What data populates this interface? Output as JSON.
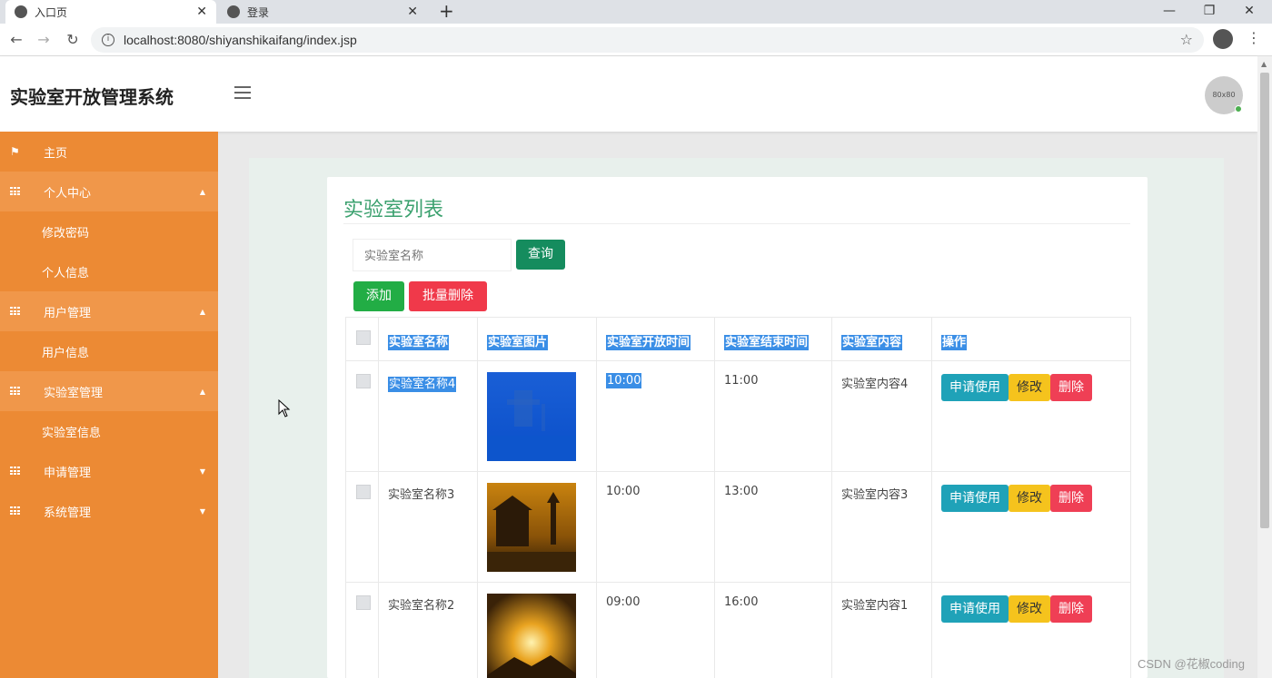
{
  "browser": {
    "tabs": [
      {
        "title": "入口页",
        "active": true
      },
      {
        "title": "登录",
        "active": false
      }
    ],
    "new_tab": "+",
    "url": "localhost:8080/shiyanshikaifang/index.jsp",
    "win_min": "—",
    "win_restore": "❐",
    "win_close": "✕"
  },
  "app": {
    "title": "实验室开放管理系统",
    "avatar_text": "80x80"
  },
  "sidebar": {
    "items": [
      {
        "label": "主页",
        "type": "top",
        "icon": "flag-icon"
      },
      {
        "label": "个人中心",
        "type": "group",
        "icon": "grid-icon",
        "caret": "▲"
      },
      {
        "label": "修改密码",
        "type": "sub"
      },
      {
        "label": "个人信息",
        "type": "sub"
      },
      {
        "label": "用户管理",
        "type": "group",
        "icon": "grid-icon",
        "caret": "▲"
      },
      {
        "label": "用户信息",
        "type": "sub"
      },
      {
        "label": "实验室管理",
        "type": "group",
        "icon": "grid-icon",
        "caret": "▲"
      },
      {
        "label": "实验室信息",
        "type": "sub"
      },
      {
        "label": "申请管理",
        "type": "top",
        "icon": "grid-icon",
        "caret": "▼"
      },
      {
        "label": "系统管理",
        "type": "top",
        "icon": "grid-icon",
        "caret": "▼"
      }
    ]
  },
  "main": {
    "title": "实验室列表",
    "search_placeholder": "实验室名称",
    "search_button": "查询",
    "add_button": "添加",
    "batch_delete_button": "批量删除",
    "columns": [
      "实验室名称",
      "实验室图片",
      "实验室开放时间",
      "实验室结束时间",
      "实验室内容",
      "操作"
    ],
    "rows": [
      {
        "name": "实验室名称4",
        "open": "10:00",
        "close": "11:00",
        "content": "实验室内容4",
        "image": "blue-tower",
        "selected": true
      },
      {
        "name": "实验室名称3",
        "open": "10:00",
        "close": "13:00",
        "content": "实验室内容3",
        "image": "golden-pagoda",
        "selected": false
      },
      {
        "name": "实验室名称2",
        "open": "09:00",
        "close": "16:00",
        "content": "实验室内容1",
        "image": "sunset-sky",
        "selected": false
      }
    ],
    "action_labels": {
      "apply": "申请使用",
      "edit": "修改",
      "delete": "删除"
    }
  },
  "watermark": "CSDN @花椒coding",
  "colors": {
    "sidebar_bg": "#ec8a34",
    "sidebar_group_bg": "#f0974a",
    "title_green": "#3ca16f",
    "search_btn": "#158c5e",
    "add_btn": "#22ad45",
    "delete_btn": "#f0394a",
    "apply_btn": "#1fa2b8",
    "edit_btn": "#f5c31d",
    "selection": "#3a8ee6"
  }
}
